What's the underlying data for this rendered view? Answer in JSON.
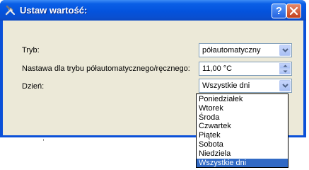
{
  "window": {
    "title": "Ustaw wartość:",
    "help_label": "?",
    "close_label": "✕"
  },
  "form": {
    "mode": {
      "label": "Tryb:",
      "value": "półautomatyczny"
    },
    "setpoint": {
      "label": "Nastawa dla trybu półautomatycznego/ręcznego:",
      "value": "11,00 °C"
    },
    "day": {
      "label": "Dzień:",
      "value": "Wszystkie dni"
    }
  },
  "day_options": [
    "Poniedziałek",
    "Wtorek",
    "Środa",
    "Czwartek",
    "Piątek",
    "Sobota",
    "Niedziela",
    "Wszystkie dni"
  ],
  "selected_day_index": 7,
  "icons": {
    "title": "tools-icon"
  },
  "colors": {
    "titlebar": "#0453dd",
    "client": "#ece9d8",
    "selection": "#316ac5",
    "combo_border": "#7f9db9"
  }
}
